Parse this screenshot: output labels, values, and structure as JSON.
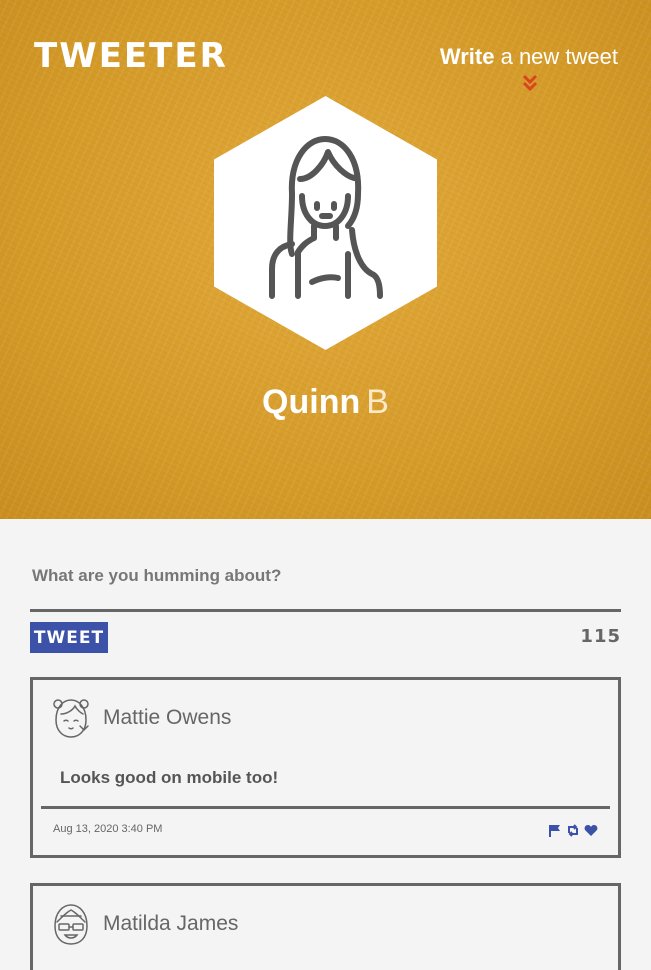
{
  "header": {
    "brand": "Tweeter",
    "write_strong": "Write",
    "write_light": "a new tweet",
    "write_icon": "double-chevron-down-icon"
  },
  "profile": {
    "first_name": "Quinn",
    "last_name": "B",
    "avatar_icon": "woman-avatar-icon"
  },
  "composer": {
    "placeholder": "What are you humming about?",
    "button_label": "Tweet",
    "char_count": "115"
  },
  "colors": {
    "hero_bg": "#d99e2b",
    "button_bg": "#3c52a8",
    "action_icon": "#3c52a8",
    "chevron": "#d9451f"
  },
  "tweets": [
    {
      "author": "Mattie Owens",
      "avatar_icon": "girl-avatar-icon",
      "text": "Looks good on mobile too!",
      "date": "Aug 13, 2020 3:40 PM",
      "actions": [
        "flag-icon",
        "retweet-icon",
        "heart-icon"
      ]
    },
    {
      "author": "Matilda James",
      "avatar_icon": "girl-with-glasses-avatar-icon",
      "text": "",
      "date": "",
      "actions": []
    }
  ]
}
